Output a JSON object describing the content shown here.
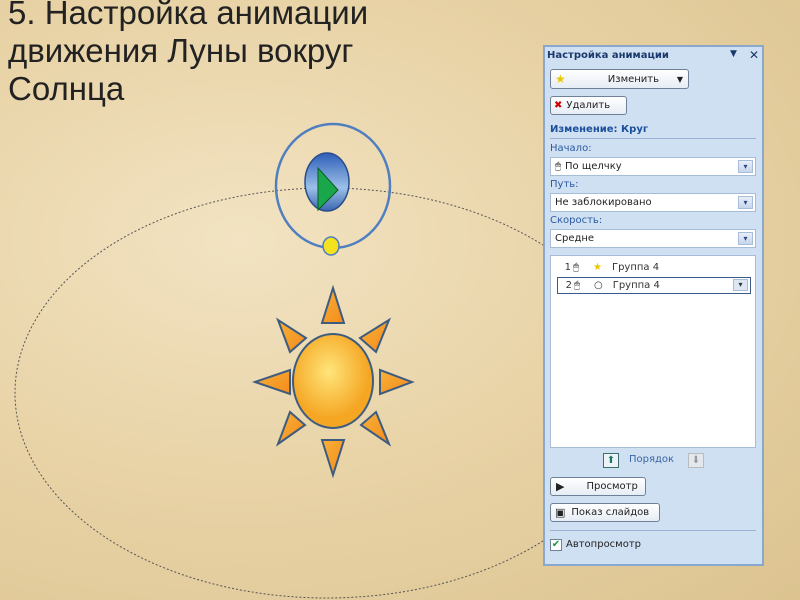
{
  "slide": {
    "title_lines": [
      "5. Настройка анимации",
      "движения Луны вокруг",
      "Солнца"
    ]
  },
  "panel": {
    "title": "Настройка анимации",
    "change_label": "Изменить",
    "delete_label": "Удалить",
    "effect_heading": "Изменение: Круг",
    "start_label": "Начало:",
    "start_value": "По щелчку",
    "path_label": "Путь:",
    "path_value": "Не заблокировано",
    "speed_label": "Скорость:",
    "speed_value": "Средне",
    "items": [
      {
        "num": "1",
        "name": "Группа 4"
      },
      {
        "num": "2",
        "name": "Группа 4"
      }
    ],
    "order_label": "Порядок",
    "preview_label": "Просмотр",
    "slideshow_label": "Показ слайдов",
    "autopreview_label": "Автопросмотр",
    "autopreview_checked": true
  }
}
